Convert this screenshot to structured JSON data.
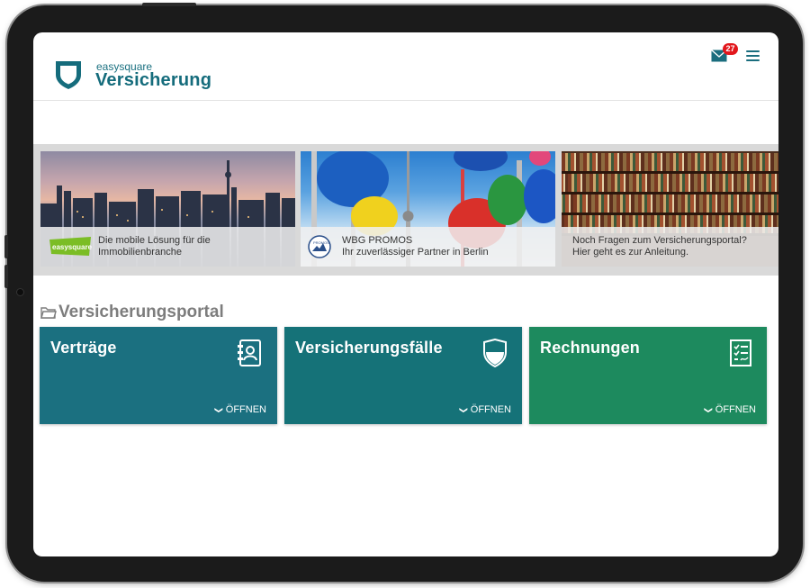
{
  "header": {
    "brand_small": "easysquare",
    "brand_big": "Versicherung",
    "mail_count": "27"
  },
  "banners": [
    {
      "line1": "Die mobile Lösung für die",
      "line2": "Immobilienbranche",
      "logo_text": "easysquare"
    },
    {
      "line1": "WBG PROMOS",
      "line2": "Ihr zuverlässiger Partner in Berlin",
      "logo_text": "PROMOS"
    },
    {
      "line1": "Noch Fragen zum Versicherungsportal?",
      "line2": "Hier geht es zur Anleitung."
    }
  ],
  "section": {
    "title": "Versicherungsportal"
  },
  "cards": [
    {
      "title": "Verträge",
      "open_label": "ÖFFNEN",
      "icon": "contacts-book-icon",
      "color": "#1b7080"
    },
    {
      "title": "Versicherungsfälle",
      "open_label": "ÖFFNEN",
      "icon": "shield-icon",
      "color": "#157278"
    },
    {
      "title": "Rechnungen",
      "open_label": "ÖFFNEN",
      "icon": "checklist-icon",
      "color": "#1d8a5e"
    }
  ],
  "colors": {
    "brand": "#156c7c",
    "badge": "#e2171c"
  }
}
